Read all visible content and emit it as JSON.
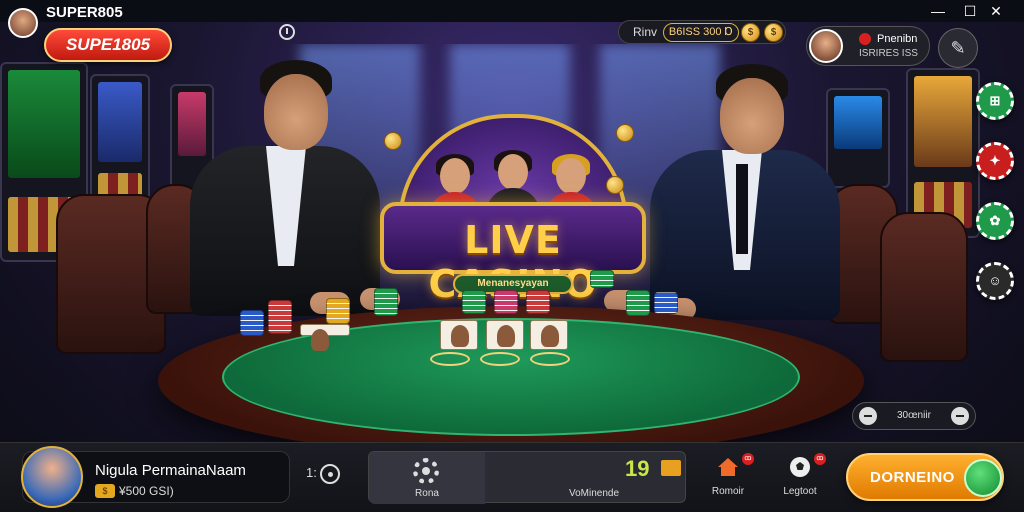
{
  "app": {
    "title": "SUPER805",
    "logo_text": "SUPE1805"
  },
  "header": {
    "balance_label": "Rinv",
    "balance_value": "B6ISS 300 Ɒ",
    "coin_glyph": "$",
    "user_name": "Pnenibn",
    "user_sub": "ISRIRES ISS",
    "window_controls": {
      "minimize": "—",
      "maximize": "☐",
      "close": "✕"
    }
  },
  "scene": {
    "sign_title": "LIVE CASINO",
    "sign_subtitle": "Menanesyayan"
  },
  "side_chips": [
    {
      "icon": "chip-icon",
      "label": "⊞",
      "color": "#1f9a4a"
    },
    {
      "icon": "chip-icon",
      "label": "✦",
      "color": "#c81e1e"
    },
    {
      "icon": "chip-icon",
      "label": "✿",
      "color": "#1f9a4a"
    },
    {
      "icon": "emoji-icon",
      "label": "☺",
      "color": "#2a2a2a"
    }
  ],
  "sound": {
    "label": "30œniir"
  },
  "bottom": {
    "player_name": "Nigula PermainaNaam",
    "player_balance": "¥500 GSI)",
    "player_coin": "$",
    "timer_label": "1:",
    "home_label": "Rona",
    "count": "19",
    "mode_label": "VoMinende",
    "actions": [
      {
        "icon": "house-icon",
        "label": "Romoir",
        "badge": "ꝏ"
      },
      {
        "icon": "soccer-icon",
        "label": "Legtoot",
        "badge": "ꝏ"
      }
    ],
    "cta_label": "DORNEINO"
  },
  "colors": {
    "accent_gold": "#e3b23c",
    "felt_green": "#1f9a5a",
    "brand_red": "#e02a1a",
    "cta_orange": "#f59a10"
  }
}
